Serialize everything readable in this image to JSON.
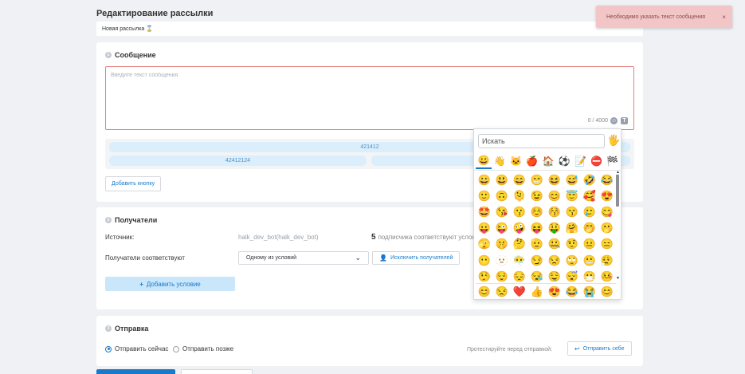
{
  "page": {
    "title": "Редактирование рассылки",
    "mailing_name": "Новая рассылка ⌛"
  },
  "message": {
    "step": "1",
    "title": "Сообщение",
    "placeholder": "Введите текст сообщения",
    "counter": "0 / 4000",
    "var_icon_glyph": "T",
    "keyboard_buttons": [
      "421412",
      "42412124"
    ],
    "add_button": "Добавить кнопку"
  },
  "recipients": {
    "step": "2",
    "title": "Получатели",
    "source_label": "Источник:",
    "source_value": "halk_dev_bot(halk_dev_bot)",
    "subscriber_count": "5",
    "subscriber_text": "подписчика соответствуют условиям",
    "match_label": "Получатели соответствуют",
    "match_select": "Одному из условий",
    "exclude_button": "Исключить получателей",
    "add_condition": "Добавить условие"
  },
  "sending": {
    "step": "3",
    "title": "Отправка",
    "send_now": "Отправить сейчас",
    "send_later": "Отправить позже",
    "test_label": "Протестируйте перед отправкой:",
    "send_self": "Отправить себе"
  },
  "toast": {
    "text": "Необходимо указать текст сообщения",
    "close": "×"
  },
  "emoji_picker": {
    "search_placeholder": "Искать",
    "skin_tone": "🖐",
    "categories": [
      "😀",
      "👋",
      "🐱",
      "🍎",
      "🏠",
      "⚽",
      "📝",
      "⛔",
      "🏁"
    ],
    "rows": [
      [
        "😀",
        "😃",
        "😄",
        "😁",
        "😆",
        "😅",
        "🤣",
        "😂"
      ],
      [
        "🙂",
        "🙃",
        "🫠",
        "😉",
        "😊",
        "😇",
        "🥰",
        "😍"
      ],
      [
        "🤩",
        "😘",
        "😗",
        "☺️",
        "😚",
        "😙",
        "🥲",
        "😋"
      ],
      [
        "😛",
        "😜",
        "🤪",
        "😝",
        "🤑",
        "🤗",
        "🤭",
        "🫢"
      ],
      [
        "🫣",
        "🤫",
        "🤔",
        "🫡",
        "🤐",
        "🤨",
        "😐",
        "😑"
      ],
      [
        "😶",
        "🫥",
        "😶‍🌫️",
        "😏",
        "😒",
        "🙄",
        "😬",
        "😮‍💨"
      ],
      [
        "🤥",
        "😌",
        "😔",
        "😪",
        "🤤",
        "😴",
        "😷",
        "🤒"
      ]
    ],
    "recent": [
      "😊",
      "😒",
      "❤️",
      "👍",
      "😍",
      "😂",
      "😭",
      "😊"
    ]
  },
  "colors": {
    "accent": "#1a7ac9",
    "error_border": "#e3807e",
    "toast_bg": "#f2c6c7",
    "kb_button": "#dbeefb"
  }
}
